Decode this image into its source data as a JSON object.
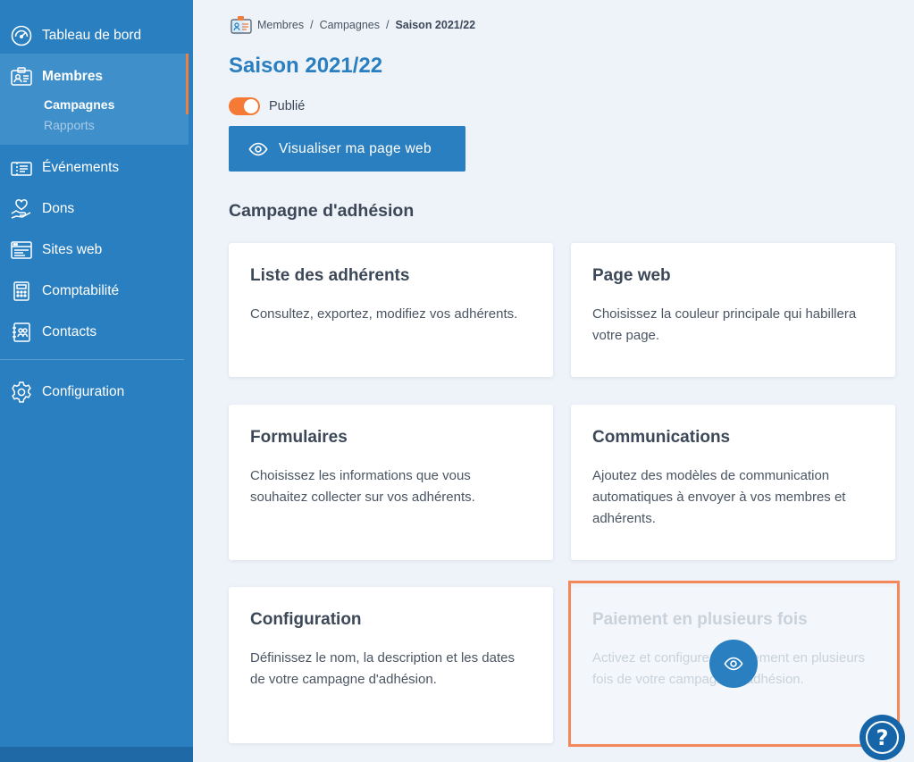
{
  "sidebar": {
    "items": [
      {
        "label": "Tableau de bord",
        "icon": "dashboard-icon"
      },
      {
        "label": "Membres",
        "icon": "member-card-icon"
      },
      {
        "label": "Événements",
        "icon": "ticket-icon"
      },
      {
        "label": "Dons",
        "icon": "heart-hand-icon"
      },
      {
        "label": "Sites web",
        "icon": "website-icon"
      },
      {
        "label": "Comptabilité",
        "icon": "calculator-icon"
      },
      {
        "label": "Contacts",
        "icon": "contacts-icon"
      },
      {
        "label": "Configuration",
        "icon": "gear-icon"
      }
    ],
    "sub_items": [
      {
        "label": "Campagnes"
      },
      {
        "label": "Rapports"
      }
    ]
  },
  "breadcrumb": {
    "items": [
      "Membres",
      "Campagnes"
    ],
    "separator": "/",
    "current": "Saison 2021/22"
  },
  "page": {
    "title": "Saison 2021/22",
    "status_label": "Publié",
    "status_on": true,
    "view_button_label": "Visualiser ma page web",
    "section_title": "Campagne d'adhésion"
  },
  "cards": [
    {
      "title": "Liste des adhérents",
      "description": "Consultez, exportez, modifiez vos adhérents."
    },
    {
      "title": "Page web",
      "description": "Choisissez la couleur principale qui habillera votre page."
    },
    {
      "title": "Formulaires",
      "description": "Choisissez les informations que vous souhaitez collecter sur vos adhérents."
    },
    {
      "title": "Communications",
      "description": "Ajoutez des modèles de communication automatiques à envoyer à vos membres et adhérents."
    },
    {
      "title": "Configuration",
      "description": "Définissez le nom, la description et les dates de votre campagne d'adhésion."
    },
    {
      "title": "Paiement en plusieurs fois",
      "description": "Activez et configurez le paiement en plusieurs fois de votre campagne d’adhésion.",
      "disabled": true
    }
  ],
  "help": {
    "label": "?"
  },
  "colors": {
    "sidebar": "#2a7fc0",
    "accent": "#f47a35",
    "highlight": "#f4885a",
    "primary": "#2a7fc0"
  }
}
